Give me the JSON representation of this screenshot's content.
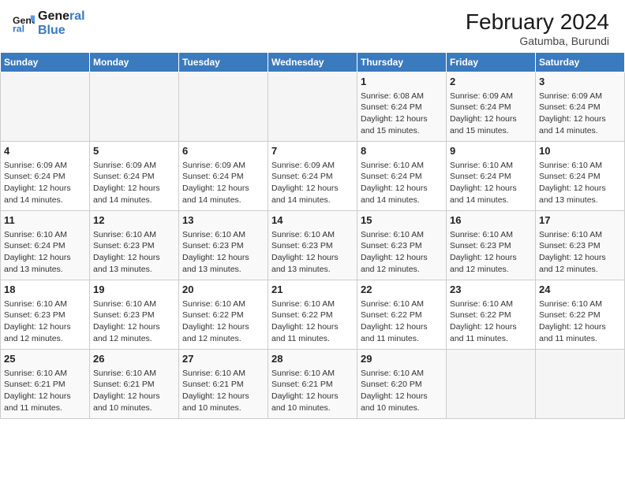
{
  "header": {
    "logo_line1": "General",
    "logo_line2": "Blue",
    "month": "February 2024",
    "location": "Gatumba, Burundi"
  },
  "days_of_week": [
    "Sunday",
    "Monday",
    "Tuesday",
    "Wednesday",
    "Thursday",
    "Friday",
    "Saturday"
  ],
  "weeks": [
    [
      {
        "day": "",
        "info": ""
      },
      {
        "day": "",
        "info": ""
      },
      {
        "day": "",
        "info": ""
      },
      {
        "day": "",
        "info": ""
      },
      {
        "day": "1",
        "info": "Sunrise: 6:08 AM\nSunset: 6:24 PM\nDaylight: 12 hours\nand 15 minutes."
      },
      {
        "day": "2",
        "info": "Sunrise: 6:09 AM\nSunset: 6:24 PM\nDaylight: 12 hours\nand 15 minutes."
      },
      {
        "day": "3",
        "info": "Sunrise: 6:09 AM\nSunset: 6:24 PM\nDaylight: 12 hours\nand 14 minutes."
      }
    ],
    [
      {
        "day": "4",
        "info": "Sunrise: 6:09 AM\nSunset: 6:24 PM\nDaylight: 12 hours\nand 14 minutes."
      },
      {
        "day": "5",
        "info": "Sunrise: 6:09 AM\nSunset: 6:24 PM\nDaylight: 12 hours\nand 14 minutes."
      },
      {
        "day": "6",
        "info": "Sunrise: 6:09 AM\nSunset: 6:24 PM\nDaylight: 12 hours\nand 14 minutes."
      },
      {
        "day": "7",
        "info": "Sunrise: 6:09 AM\nSunset: 6:24 PM\nDaylight: 12 hours\nand 14 minutes."
      },
      {
        "day": "8",
        "info": "Sunrise: 6:10 AM\nSunset: 6:24 PM\nDaylight: 12 hours\nand 14 minutes."
      },
      {
        "day": "9",
        "info": "Sunrise: 6:10 AM\nSunset: 6:24 PM\nDaylight: 12 hours\nand 14 minutes."
      },
      {
        "day": "10",
        "info": "Sunrise: 6:10 AM\nSunset: 6:24 PM\nDaylight: 12 hours\nand 13 minutes."
      }
    ],
    [
      {
        "day": "11",
        "info": "Sunrise: 6:10 AM\nSunset: 6:24 PM\nDaylight: 12 hours\nand 13 minutes."
      },
      {
        "day": "12",
        "info": "Sunrise: 6:10 AM\nSunset: 6:23 PM\nDaylight: 12 hours\nand 13 minutes."
      },
      {
        "day": "13",
        "info": "Sunrise: 6:10 AM\nSunset: 6:23 PM\nDaylight: 12 hours\nand 13 minutes."
      },
      {
        "day": "14",
        "info": "Sunrise: 6:10 AM\nSunset: 6:23 PM\nDaylight: 12 hours\nand 13 minutes."
      },
      {
        "day": "15",
        "info": "Sunrise: 6:10 AM\nSunset: 6:23 PM\nDaylight: 12 hours\nand 12 minutes."
      },
      {
        "day": "16",
        "info": "Sunrise: 6:10 AM\nSunset: 6:23 PM\nDaylight: 12 hours\nand 12 minutes."
      },
      {
        "day": "17",
        "info": "Sunrise: 6:10 AM\nSunset: 6:23 PM\nDaylight: 12 hours\nand 12 minutes."
      }
    ],
    [
      {
        "day": "18",
        "info": "Sunrise: 6:10 AM\nSunset: 6:23 PM\nDaylight: 12 hours\nand 12 minutes."
      },
      {
        "day": "19",
        "info": "Sunrise: 6:10 AM\nSunset: 6:23 PM\nDaylight: 12 hours\nand 12 minutes."
      },
      {
        "day": "20",
        "info": "Sunrise: 6:10 AM\nSunset: 6:22 PM\nDaylight: 12 hours\nand 12 minutes."
      },
      {
        "day": "21",
        "info": "Sunrise: 6:10 AM\nSunset: 6:22 PM\nDaylight: 12 hours\nand 11 minutes."
      },
      {
        "day": "22",
        "info": "Sunrise: 6:10 AM\nSunset: 6:22 PM\nDaylight: 12 hours\nand 11 minutes."
      },
      {
        "day": "23",
        "info": "Sunrise: 6:10 AM\nSunset: 6:22 PM\nDaylight: 12 hours\nand 11 minutes."
      },
      {
        "day": "24",
        "info": "Sunrise: 6:10 AM\nSunset: 6:22 PM\nDaylight: 12 hours\nand 11 minutes."
      }
    ],
    [
      {
        "day": "25",
        "info": "Sunrise: 6:10 AM\nSunset: 6:21 PM\nDaylight: 12 hours\nand 11 minutes."
      },
      {
        "day": "26",
        "info": "Sunrise: 6:10 AM\nSunset: 6:21 PM\nDaylight: 12 hours\nand 10 minutes."
      },
      {
        "day": "27",
        "info": "Sunrise: 6:10 AM\nSunset: 6:21 PM\nDaylight: 12 hours\nand 10 minutes."
      },
      {
        "day": "28",
        "info": "Sunrise: 6:10 AM\nSunset: 6:21 PM\nDaylight: 12 hours\nand 10 minutes."
      },
      {
        "day": "29",
        "info": "Sunrise: 6:10 AM\nSunset: 6:20 PM\nDaylight: 12 hours\nand 10 minutes."
      },
      {
        "day": "",
        "info": ""
      },
      {
        "day": "",
        "info": ""
      }
    ]
  ]
}
